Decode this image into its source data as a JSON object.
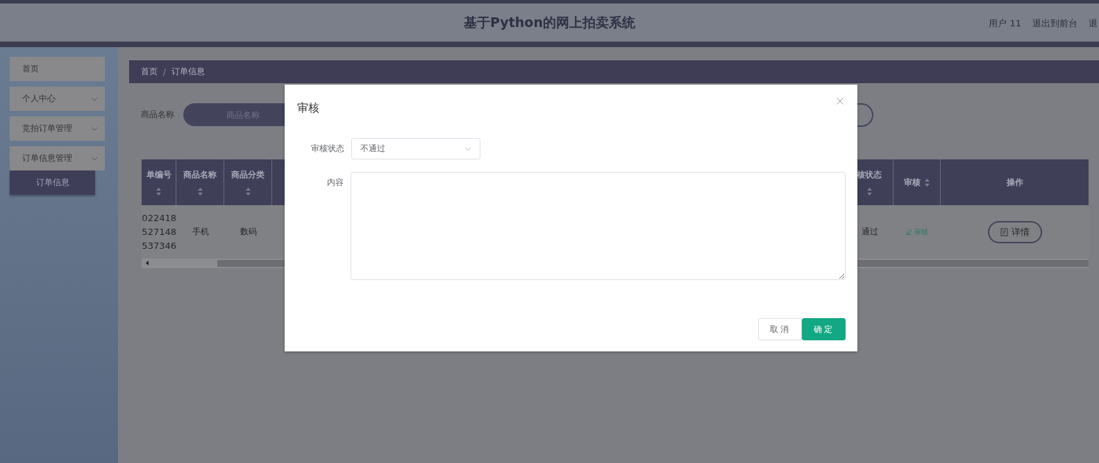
{
  "header": {
    "title": "基于Python的网上拍卖系统",
    "links": [
      "用户 11",
      "退出到前台",
      "退"
    ]
  },
  "sidebar": {
    "items": [
      {
        "label": "首页",
        "kind": "link"
      },
      {
        "label": "个人中心",
        "kind": "submenu"
      },
      {
        "label": "竞拍订单管理",
        "kind": "submenu"
      },
      {
        "label": "订单信息管理",
        "kind": "submenu",
        "children": [
          {
            "label": "订单信息",
            "selected": true
          }
        ]
      }
    ]
  },
  "breadcrumb": {
    "items": [
      "首页",
      "订单信息"
    ],
    "separator": "/"
  },
  "search": {
    "label": "商品名称",
    "placeholder": "商品名称"
  },
  "table": {
    "left_columns": [
      {
        "label": "单编号",
        "sortable": true
      },
      {
        "label": "商品名称",
        "sortable": true
      },
      {
        "label": "商品分类",
        "sortable": true
      }
    ],
    "right_columns": [
      {
        "label": "核状态",
        "sortable": true
      },
      {
        "label": "审核",
        "sortable": true
      },
      {
        "label": "操作",
        "sortable": false
      }
    ],
    "rows": [
      {
        "left_cells": [
          {
            "kind": "lines",
            "lines": [
              "022418",
              "527148",
              "537346"
            ]
          },
          {
            "kind": "text",
            "text": "手机"
          },
          {
            "kind": "text",
            "text": "数码"
          }
        ],
        "right_cells": [
          {
            "kind": "text",
            "text": "通过"
          },
          {
            "kind": "link",
            "text": "审核"
          },
          {
            "kind": "button",
            "text": "详情"
          }
        ]
      }
    ]
  },
  "dialog": {
    "title": "审核",
    "fields": [
      {
        "kind": "select",
        "label": "审核状态",
        "value": "不通过"
      },
      {
        "kind": "textarea",
        "label": "内容"
      }
    ],
    "buttons": [
      {
        "label": "取消",
        "primary": false
      },
      {
        "label": "确定",
        "primary": true
      }
    ]
  }
}
